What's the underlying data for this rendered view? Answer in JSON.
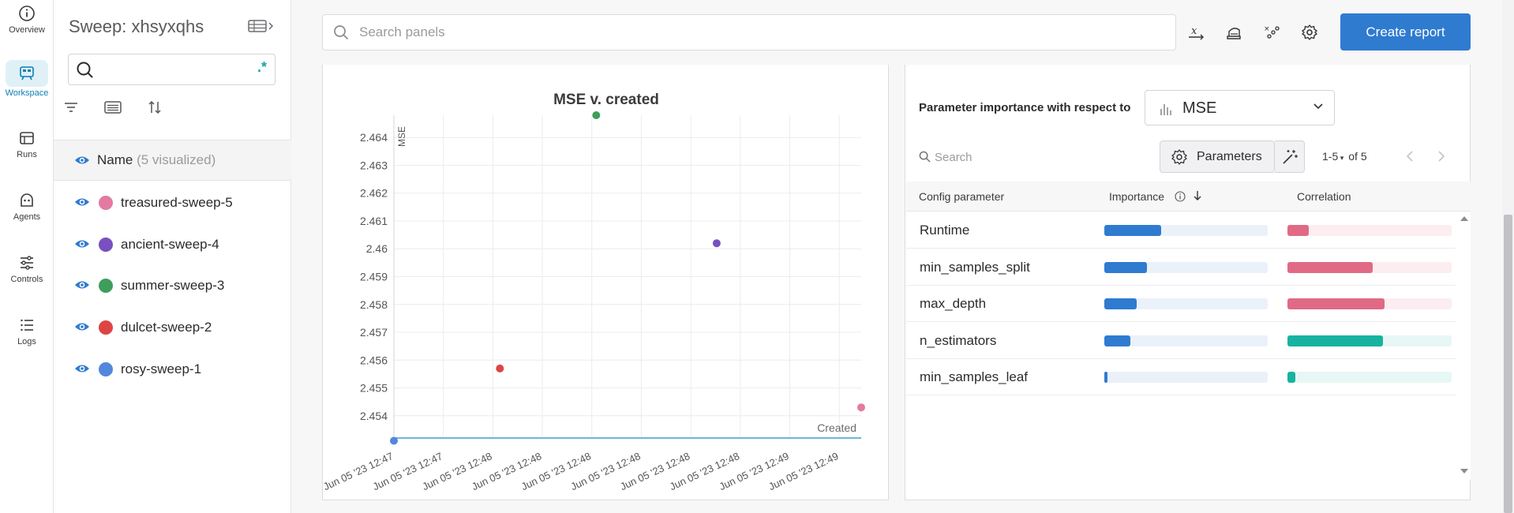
{
  "nav": {
    "items": [
      {
        "label": "Overview",
        "icon": "info-icon"
      },
      {
        "label": "Workspace",
        "icon": "workspace-icon",
        "active": true
      },
      {
        "label": "Runs",
        "icon": "table-icon"
      },
      {
        "label": "Agents",
        "icon": "agent-icon"
      },
      {
        "label": "Controls",
        "icon": "sliders-icon"
      },
      {
        "label": "Logs",
        "icon": "list-icon"
      }
    ]
  },
  "runs": {
    "title": "Sweep: xhsyxqhs",
    "search_value": "",
    "regex_label": ".*",
    "name_header": "Name",
    "name_count": "(5 visualized)",
    "items": [
      {
        "name": "treasured-sweep-5",
        "color": "#e37aa1"
      },
      {
        "name": "ancient-sweep-4",
        "color": "#7a4fbf"
      },
      {
        "name": "summer-sweep-3",
        "color": "#3f9e5b"
      },
      {
        "name": "dulcet-sweep-2",
        "color": "#dc4544"
      },
      {
        "name": "rosy-sweep-1",
        "color": "#5387dd"
      }
    ]
  },
  "top": {
    "search_placeholder": "Search panels",
    "create_report": "Create report"
  },
  "chart_data": {
    "type": "scatter",
    "title": "MSE v. created",
    "ylabel": "MSE",
    "xlabel": "Created",
    "ylim": [
      2.4532,
      2.4648
    ],
    "yticks": [
      "2.464",
      "2.463",
      "2.462",
      "2.461",
      "2.46",
      "2.459",
      "2.458",
      "2.457",
      "2.456",
      "2.455",
      "2.454"
    ],
    "xticks": [
      "Jun 05 '23 12:47",
      "Jun 05 '23 12:47",
      "Jun 05 '23 12:48",
      "Jun 05 '23 12:48",
      "Jun 05 '23 12:48",
      "Jun 05 '23 12:48",
      "Jun 05 '23 12:48",
      "Jun 05 '23 12:48",
      "Jun 05 '23 12:49",
      "Jun 05 '23 12:49"
    ],
    "grid": true,
    "series": [
      {
        "name": "rosy-sweep-1",
        "color": "#5387dd",
        "x": 0.0,
        "y": 2.4531
      },
      {
        "name": "dulcet-sweep-2",
        "color": "#dc4544",
        "x": 2.2,
        "y": 2.4557
      },
      {
        "name": "summer-sweep-3",
        "color": "#3f9e5b",
        "x": 4.2,
        "y": 2.4648
      },
      {
        "name": "ancient-sweep-4",
        "color": "#7a4fbf",
        "x": 6.7,
        "y": 2.4602
      },
      {
        "name": "treasured-sweep-5",
        "color": "#e37aa1",
        "x": 9.7,
        "y": 2.4543
      }
    ]
  },
  "params": {
    "label": "Parameter importance with respect to",
    "metric": "MSE",
    "search_placeholder": "Search",
    "parameters_button": "Parameters",
    "range": "1-5",
    "of": "of 5",
    "headers": {
      "param": "Config parameter",
      "importance": "Importance",
      "correlation": "Correlation"
    },
    "rows": [
      {
        "name": "Runtime",
        "importance": 0.35,
        "correlation": 0.13,
        "corr_color": "#e06a85",
        "corr_bg": "#fcedf0"
      },
      {
        "name": "min_samples_split",
        "importance": 0.26,
        "correlation": 0.52,
        "corr_color": "#e06a85",
        "corr_bg": "#fcedf0"
      },
      {
        "name": "max_depth",
        "importance": 0.2,
        "correlation": 0.59,
        "corr_color": "#e06a85",
        "corr_bg": "#fcedf0"
      },
      {
        "name": "n_estimators",
        "importance": 0.16,
        "correlation": 0.58,
        "corr_color": "#17b3a0",
        "corr_bg": "#e7f7f5"
      },
      {
        "name": "min_samples_leaf",
        "importance": 0.02,
        "correlation": 0.05,
        "corr_color": "#17b3a0",
        "corr_bg": "#e7f7f5"
      }
    ]
  }
}
